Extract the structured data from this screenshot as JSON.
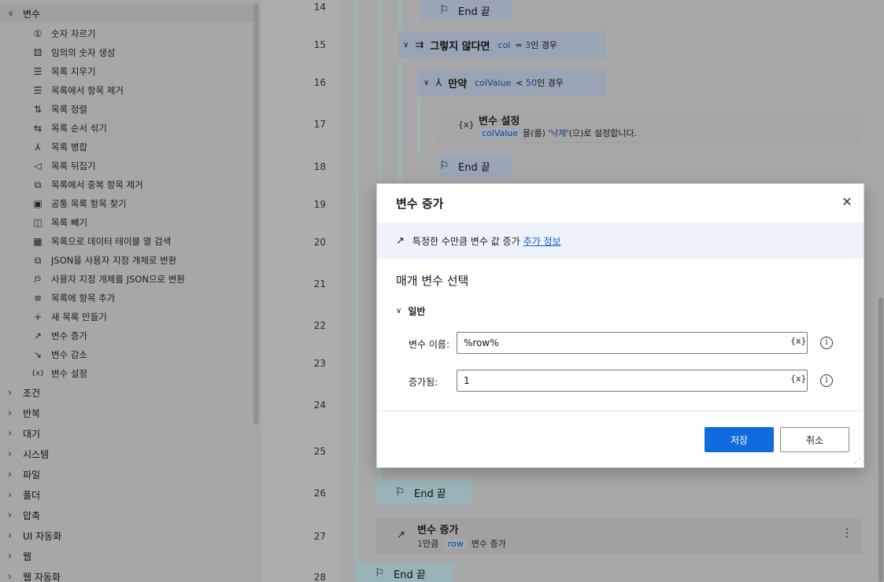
{
  "sidebar": {
    "top_group": "변수",
    "items": [
      {
        "icon": "①",
        "label": "숫자 자르기"
      },
      {
        "icon": "⚄",
        "label": "임의의 숫자 생성"
      },
      {
        "icon": "☰",
        "label": "목록 지우기"
      },
      {
        "icon": "☰",
        "label": "목록에서 항목 제거"
      },
      {
        "icon": "⇅",
        "label": "목록 정렬"
      },
      {
        "icon": "⇆",
        "label": "목록 순서 섞기"
      },
      {
        "icon": "⅄",
        "label": "목록 병합"
      },
      {
        "icon": "◁",
        "label": "목록 뒤집기"
      },
      {
        "icon": "⧉",
        "label": "목록에서 중복 항목 제거"
      },
      {
        "icon": "▣",
        "label": "공통 목록 항목 찾기"
      },
      {
        "icon": "◫",
        "label": "목록 빼기"
      },
      {
        "icon": "▦",
        "label": "목록으로 데이터 테이블 열 검색"
      },
      {
        "icon": "⧉",
        "label": "JSON을 사용자 지정 개체로 변환"
      },
      {
        "icon": "JS",
        "label": "사용자 지정 개체를 JSON으로 변환"
      },
      {
        "icon": "≡",
        "label": "목록에 항목 추가"
      },
      {
        "icon": "+",
        "label": "새 목록 만들기"
      },
      {
        "icon": "↗",
        "label": "변수 증가"
      },
      {
        "icon": "↘",
        "label": "변수 감소"
      },
      {
        "icon": "{x}",
        "label": "변수 설정"
      }
    ],
    "groups": [
      "조건",
      "반복",
      "대기",
      "시스템",
      "파일",
      "폴더",
      "압축",
      "UI 자동화",
      "웹",
      "웹 자동화"
    ]
  },
  "canvas": {
    "line_numbers": [
      "14",
      "15",
      "16",
      "17",
      "18",
      "19",
      "20",
      "21",
      "22",
      "23",
      "24",
      "25",
      "26",
      "27",
      "28"
    ],
    "end_label": "End 끝",
    "else_if": {
      "keyword": "그렇지 않다면",
      "var": "col",
      "op": "= ",
      "value": "3",
      "suffix": "인 경우"
    },
    "if": {
      "keyword": "만약",
      "var": "colValue",
      "op": "< ",
      "value": "50",
      "suffix": "인 경우"
    },
    "set_var": {
      "title": "변수 설정",
      "var": "colValue",
      "text1": "을(를) '",
      "value": "낙제",
      "text2": "'(으)로 설정합니다."
    },
    "increase": {
      "title": "변수 증가",
      "amount": "1",
      "text1": "만큼",
      "var": "row",
      "text2": "변수 증가"
    }
  },
  "dialog": {
    "title": "변수 증가",
    "close_glyph": "✕",
    "info_text": "특정한 수만큼 변수 값 증가",
    "info_link": "추가 정보",
    "section_title": "매개 변수 선택",
    "group_label": "일반",
    "fields": [
      {
        "label": "변수 이름:",
        "value": "%row%"
      },
      {
        "label": "증가됨:",
        "value": "1"
      }
    ],
    "var_glyph": "{x}",
    "info_glyph": "i",
    "save_label": "저장",
    "cancel_label": "취소"
  }
}
